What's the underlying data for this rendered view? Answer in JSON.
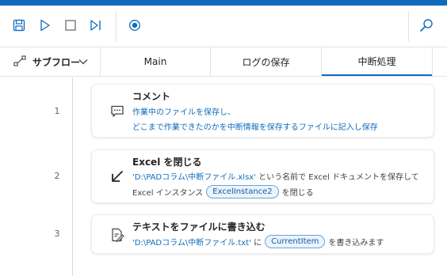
{
  "toolbar": {
    "save_icon": "save-icon",
    "run_icon": "play-icon",
    "stop_icon": "stop-icon",
    "step_icon": "run-next-step-icon",
    "record_icon": "record-icon",
    "search_icon": "search-icon",
    "accent": "#0f6cbd"
  },
  "tabs": {
    "subflow_label": "サブフロー",
    "items": [
      "Main",
      "ログの保存",
      "中断処理"
    ],
    "active_index": 2
  },
  "steps": [
    {
      "number": "1",
      "icon": "comment-icon",
      "title": "コメント",
      "lines": [
        "作業中のファイルを保存し、",
        "どこまで作業できたのかを中断情報を保存するファイルに記入し保存"
      ]
    },
    {
      "number": "2",
      "icon": "close-excel-arrow-icon",
      "title": "Excel を閉じる",
      "line1_path": "'D:\\PADコラム\\中断ファイル.xlsx'",
      "line1_suffix": " という名前で Excel ドキュメントを保存して",
      "line2_prefix": "Excel インスタンス",
      "line2_var": "ExcelInstance2",
      "line2_suffix": "を閉じる"
    },
    {
      "number": "3",
      "icon": "write-text-file-icon",
      "title": "テキストをファイルに書き込む",
      "line1_path": "'D:\\PADコラム\\中断ファイル.txt'",
      "line1_mid": " に",
      "line1_var": "CurrentItem",
      "line1_suffix": "を書き込みます"
    }
  ]
}
